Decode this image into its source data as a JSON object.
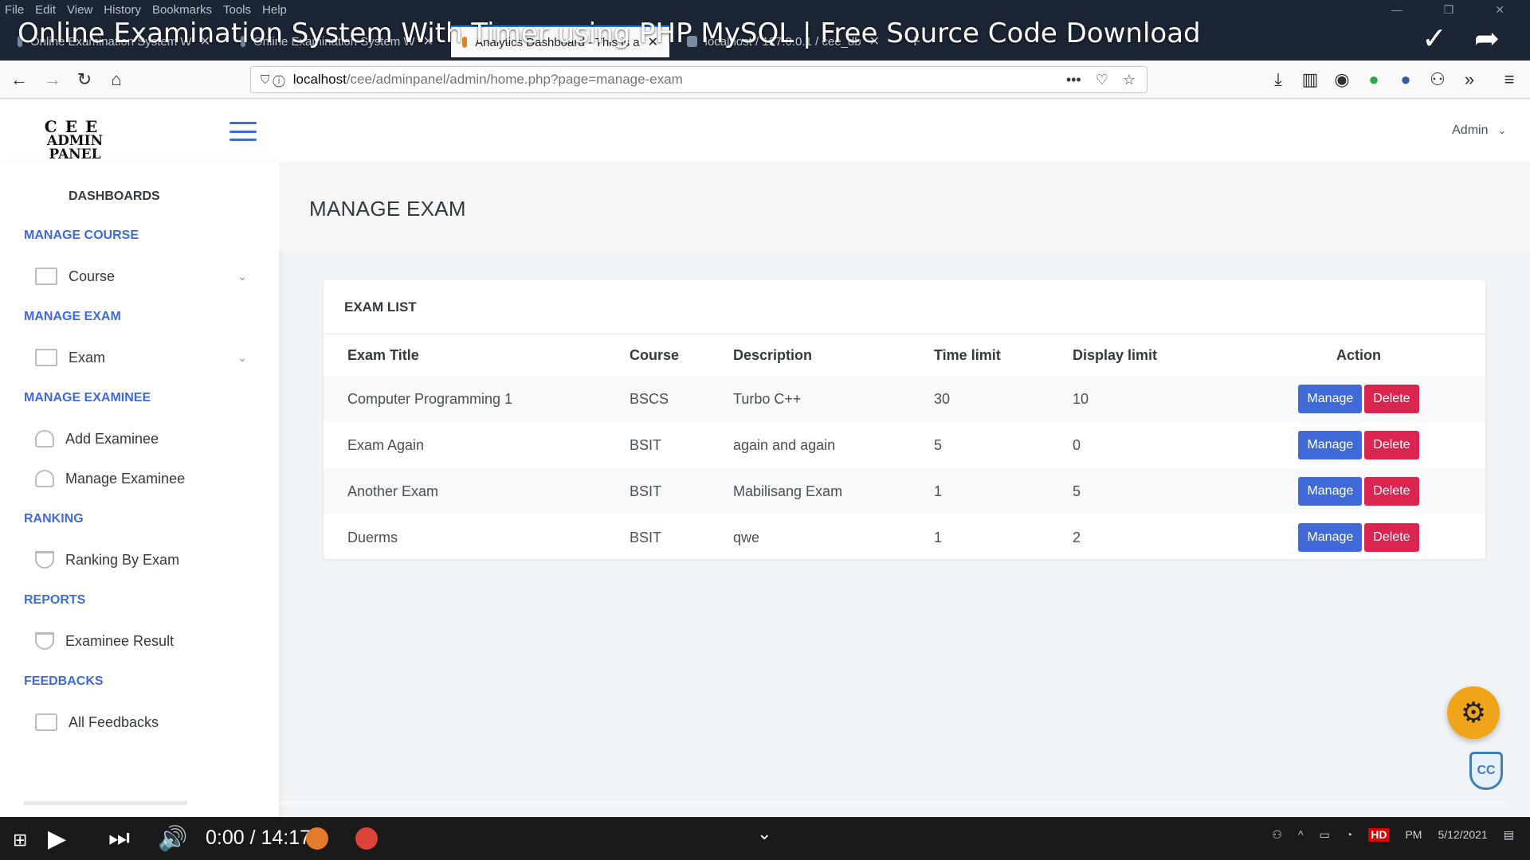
{
  "browser": {
    "menu": [
      "File",
      "Edit",
      "View",
      "History",
      "Bookmarks",
      "Tools",
      "Help"
    ],
    "tabs": [
      {
        "label": "Online Examination System W"
      },
      {
        "label": "Online Examination System W"
      },
      {
        "label": "Analytics Dashboard - This is a"
      },
      {
        "label": "localhost / 127.0.0.1 / cee_db"
      }
    ],
    "url_prefix": "localhost",
    "url_rest": "/cee/adminpanel/admin/home.php?page=manage-exam"
  },
  "video": {
    "title": "Online Examination System With Timer using PHP MySQL | Free Source Code Download",
    "time": "0:00 / 14:17",
    "progress_fraction": 0.11,
    "badge": "HD",
    "clock": "PM",
    "date": "5/12/2021"
  },
  "header": {
    "logo_line1": "CEE",
    "logo_line2": "ADMIN PANEL",
    "admin_label": "Admin"
  },
  "sidebar": {
    "dashboard": "DASHBOARDS",
    "sections": [
      {
        "heading": "MANAGE COURSE",
        "items": [
          {
            "label": "Course",
            "icon": "list-icon",
            "dropdown": true
          }
        ]
      },
      {
        "heading": "MANAGE EXAM",
        "items": [
          {
            "label": "Exam",
            "icon": "list-icon",
            "dropdown": true
          }
        ]
      },
      {
        "heading": "MANAGE EXAMINEE",
        "items": [
          {
            "label": "Add Examinee",
            "icon": "add-user-icon"
          },
          {
            "label": "Manage Examinee",
            "icon": "users-icon"
          }
        ]
      },
      {
        "heading": "RANKING",
        "items": [
          {
            "label": "Ranking By Exam",
            "icon": "trophy-icon"
          }
        ]
      },
      {
        "heading": "REPORTS",
        "items": [
          {
            "label": "Examinee Result",
            "icon": "trophy-icon"
          }
        ]
      },
      {
        "heading": "FEEDBACKS",
        "items": [
          {
            "label": "All Feedbacks",
            "icon": "chat-icon"
          }
        ]
      }
    ]
  },
  "main": {
    "page_title": "MANAGE EXAM",
    "card_title": "EXAM LIST",
    "columns": [
      "Exam Title",
      "Course",
      "Description",
      "Time limit",
      "Display limit",
      "Action"
    ],
    "rows": [
      {
        "title": "Computer Programming 1",
        "course": "BSCS",
        "description": "Turbo C++",
        "time_limit": "30",
        "display_limit": "10"
      },
      {
        "title": "Exam Again",
        "course": "BSIT",
        "description": "again and again",
        "time_limit": "5",
        "display_limit": "0"
      },
      {
        "title": "Another Exam",
        "course": "BSIT",
        "description": "Mabilisang Exam",
        "time_limit": "1",
        "display_limit": "5"
      },
      {
        "title": "Duerms",
        "course": "BSIT",
        "description": "qwe",
        "time_limit": "1",
        "display_limit": "2"
      }
    ],
    "manage_label": "Manage",
    "delete_label": "Delete"
  },
  "colors": {
    "accent": "#3f6ad8",
    "danger": "#d92550",
    "fab": "#f0a41a"
  }
}
